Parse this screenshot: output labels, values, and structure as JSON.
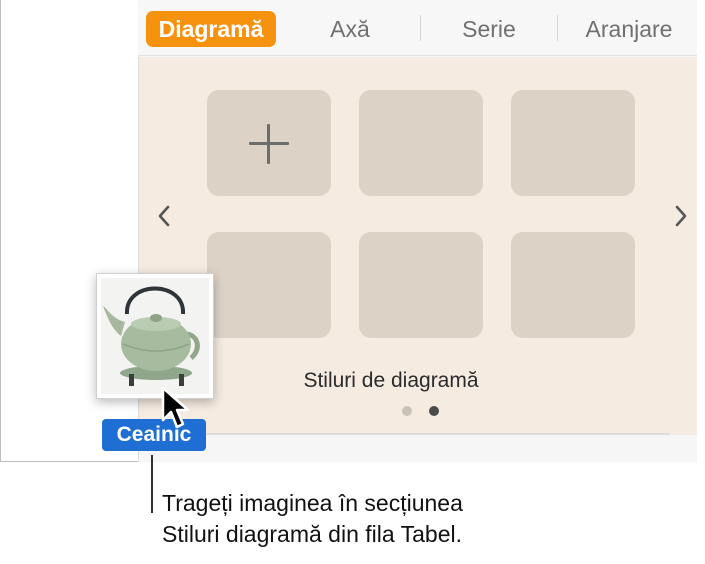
{
  "tabs": [
    {
      "label": "Diagramă",
      "active": true
    },
    {
      "label": "Axă",
      "active": false
    },
    {
      "label": "Serie",
      "active": false
    },
    {
      "label": "Aranjare",
      "active": false
    }
  ],
  "styles_panel": {
    "caption": "Stiluri de diagramă",
    "page_count": 2,
    "current_page": 2,
    "tile_count": 6
  },
  "drag": {
    "label": "Ceainic",
    "image_subject": "green cast-iron teapot"
  },
  "callout": {
    "line1": "Trageți imaginea în secțiunea",
    "line2": "Stiluri diagramă din fila Tabel."
  },
  "colors": {
    "active_tab": "#f7920f",
    "panel_background": "#f5ebe1",
    "tile": "#ddd2c6",
    "drag_label": "#1f6ed4"
  },
  "icons": [
    "plus-icon",
    "chevron-left-icon",
    "chevron-right-icon",
    "pointer-cursor-icon"
  ]
}
